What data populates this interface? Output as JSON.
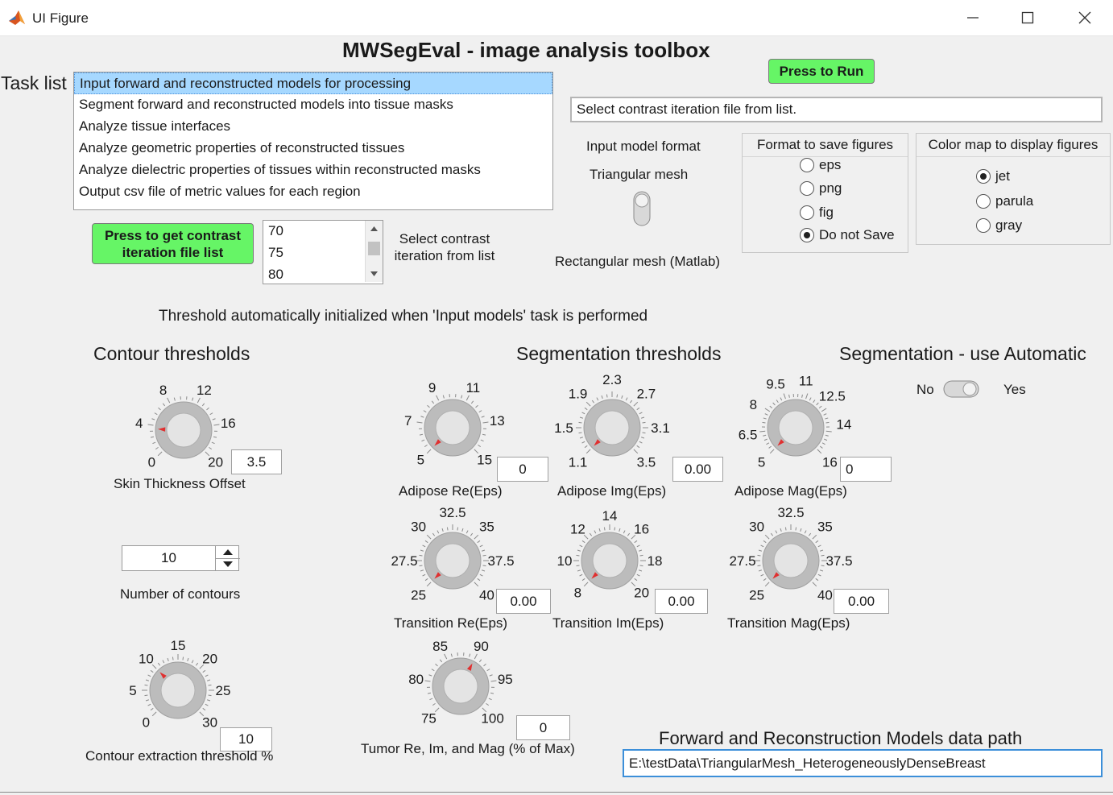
{
  "window": {
    "title": "UI Figure",
    "icon": "matlab-icon"
  },
  "app_title": "MWSegEval - image analysis toolbox",
  "run_button": "Press to Run",
  "task_list": {
    "label": "Task list",
    "items": [
      "Input forward and reconstructed models for processing",
      "Segment forward and reconstructed models into tissue masks",
      "Analyze tissue interfaces",
      "Analyze geometric properties of reconstructed tissues",
      "Analyze dielectric properties of tissues within reconstructed masks",
      "Output csv file of metric values for each region"
    ],
    "selected_index": 0
  },
  "contrast": {
    "get_button": "Press to get contrast iteration file list",
    "list_items": [
      "70",
      "75",
      "80"
    ],
    "select_label": "Select contrast iteration from list",
    "file_field": "Select contrast iteration file from list."
  },
  "input_format": {
    "title": "Input model format",
    "top_option": "Triangular mesh",
    "bottom_option": "Rectangular mesh (Matlab)",
    "state": "Triangular mesh"
  },
  "save_format": {
    "title": "Format to save figures",
    "options": [
      "eps",
      "png",
      "fig",
      "Do not Save"
    ],
    "selected": "Do not Save"
  },
  "color_map": {
    "title": "Color map to display figures",
    "options": [
      "jet",
      "parula",
      "gray"
    ],
    "selected": "jet"
  },
  "threshold_note": "Threshold automatically initialized when 'Input models' task is performed",
  "contour_thresholds": {
    "title": "Contour thresholds",
    "skin": {
      "label": "Skin Thickness Offset",
      "value": "3.5",
      "ticks": [
        "0",
        "4",
        "8",
        "12",
        "16",
        "20"
      ],
      "knob_value": 3.5
    },
    "num_contours": {
      "label": "Number of contours",
      "value": "10"
    },
    "extraction": {
      "label": "Contour extraction threshold %",
      "value": "10",
      "ticks": [
        "0",
        "5",
        "10",
        "15",
        "20",
        "25",
        "30"
      ],
      "knob_value": 10
    }
  },
  "segmentation_thresholds": {
    "title": "Segmentation thresholds",
    "knobs": {
      "adipose_re": {
        "label": "Adipose Re(Eps)",
        "value": "0",
        "ticks": [
          "5",
          "7",
          "9",
          "11",
          "13",
          "15"
        ],
        "knob_value": 5
      },
      "adipose_img": {
        "label": "Adipose Img(Eps)",
        "value": "0.00",
        "ticks": [
          "1.1",
          "1.5",
          "1.9",
          "2.3",
          "2.7",
          "3.1",
          "3.5"
        ],
        "knob_value": 1.1
      },
      "adipose_mag": {
        "label": "Adipose Mag(Eps)",
        "value": "0",
        "ticks": [
          "5",
          "6.5",
          "8",
          "9.5",
          "11",
          "12.5",
          "14",
          "16"
        ],
        "knob_value": 5
      },
      "transition_re": {
        "label": "Transition Re(Eps)",
        "value": "0.00",
        "ticks": [
          "25",
          "27.5",
          "30",
          "32.5",
          "35",
          "37.5",
          "40"
        ],
        "knob_value": 25
      },
      "transition_im": {
        "label": "Transition Im(Eps)",
        "value": "0.00",
        "ticks": [
          "8",
          "10",
          "12",
          "14",
          "16",
          "18",
          "20"
        ],
        "knob_value": 8
      },
      "transition_mag": {
        "label": "Transition Mag(Eps)",
        "value": "0.00",
        "ticks": [
          "25",
          "27.5",
          "30",
          "32.5",
          "35",
          "37.5",
          "40"
        ],
        "knob_value": 25
      },
      "tumor": {
        "label": "Tumor Re, Im, and Mag (% of Max)",
        "value": "0",
        "ticks": [
          "75",
          "80",
          "85",
          "90",
          "95",
          "100"
        ],
        "knob_value": 90
      }
    }
  },
  "auto_seg": {
    "title": "Segmentation - use Automatic",
    "off_label": "No",
    "on_label": "Yes",
    "state": "No"
  },
  "data_path": {
    "title": "Forward and Reconstruction Models data path",
    "value": "E:\\testData\\TriangularMesh_HeterogeneouslyDenseBreast"
  },
  "colors": {
    "selection": "#a6d8ff",
    "green_button": "#66f566",
    "knob_pointer": "#e03030"
  }
}
